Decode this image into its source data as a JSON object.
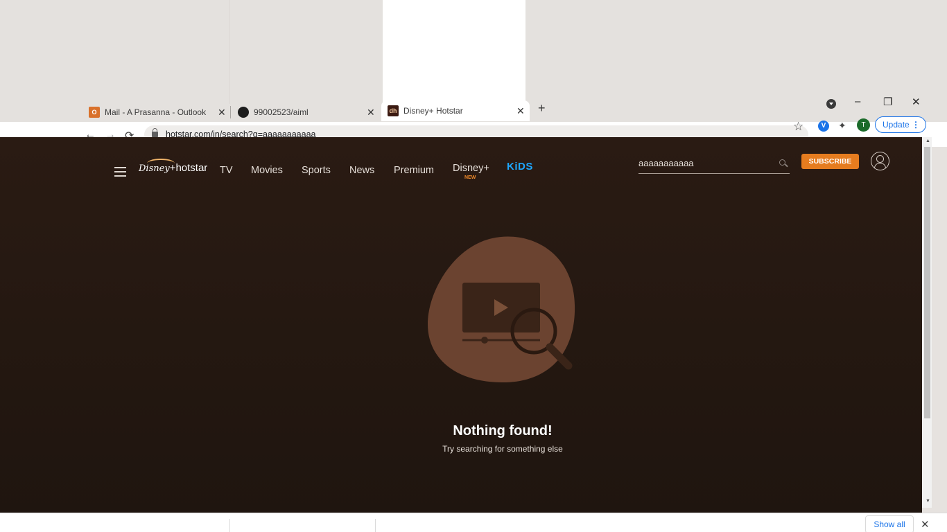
{
  "browser": {
    "tabs": [
      {
        "title": "Mail - A Prasanna - Outlook",
        "favicon": "O",
        "close": "✕"
      },
      {
        "title": "99002523/aiml",
        "favicon": "",
        "close": "✕"
      },
      {
        "title": "Disney+ Hotstar",
        "favicon": "dh",
        "close": "✕"
      }
    ],
    "new_tab": "+",
    "window": {
      "minimize": "–",
      "maximize": "❐",
      "close": "✕"
    },
    "nav": {
      "back": "←",
      "forward": "→",
      "reload": "⟳"
    },
    "url": "hotstar.com/in/search?q=aaaaaaaaaaa",
    "star": "☆",
    "extension_v": "V",
    "puzzle": "✦",
    "profile_initial": "T",
    "update_label": "Update",
    "update_menu": "⋮"
  },
  "site": {
    "nav_items": [
      "TV",
      "Movies",
      "Sports",
      "News",
      "Premium",
      "Disney+"
    ],
    "new_badge": "NEW",
    "kids_label": "KiDS",
    "logo_disney": "Disney",
    "logo_plus": "+",
    "logo_hotstar": "hotstar",
    "search_value": "aaaaaaaaaaa",
    "subscribe_label": "SUBSCRIBE",
    "empty_title": "Nothing found!",
    "empty_subtitle": "Try searching for something else"
  },
  "download_bar": {
    "show_all": "Show all",
    "close": "✕"
  },
  "colors": {
    "page_bg": "#241811",
    "accent": "#e57c1f",
    "kids": "#1ea7ff",
    "blob": "#6b4330"
  }
}
